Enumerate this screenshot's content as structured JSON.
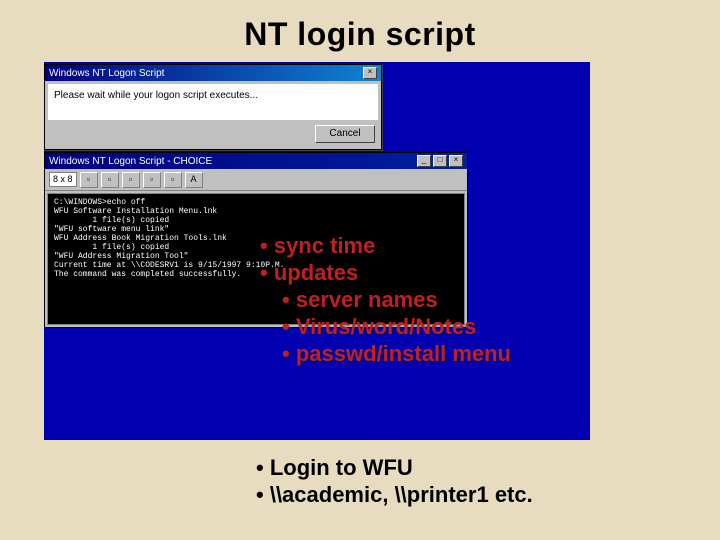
{
  "title": "NT login script",
  "dialog1": {
    "title": "Windows NT Logon Script",
    "message": "Please wait while your logon script executes...",
    "cancel": "Cancel",
    "close_label": "×"
  },
  "console": {
    "title": "Windows NT Logon Script - CHOICE",
    "min_label": "_",
    "max_label": "□",
    "close_label": "×",
    "font_size": "8 x 8",
    "tool_a": "A",
    "output": "C:\\WINDOWS>echo off\nWFU Software Installation Menu.lnk\n        1 file(s) copied\n\"WFU software menu link\"\nWFU Address Book Migration Tools.lnk\n        1 file(s) copied\n\"WFU Address Migration Tool\"\nCurrent time at \\\\CODESRV1 is 9/15/1997 9:10P.M.\nThe command was completed successfully."
  },
  "bullets1": {
    "b1": "sync time",
    "b2": "updates",
    "b3": "server names",
    "b4": "Virus/word/Notes",
    "b5": "passwd/install menu"
  },
  "bullets2": {
    "b1": "Login to WFU",
    "b2": "\\\\academic, \\\\printer1 etc."
  }
}
